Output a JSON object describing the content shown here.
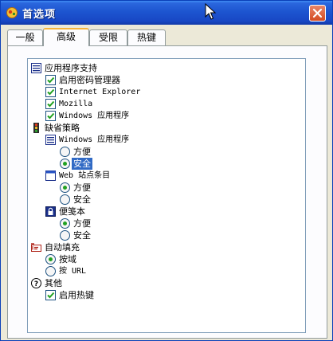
{
  "window": {
    "title": "首选项",
    "close_label": "✕"
  },
  "tabs": [
    {
      "label": "一般",
      "active": false
    },
    {
      "label": "高级",
      "active": true
    },
    {
      "label": "受限",
      "active": false
    },
    {
      "label": "热键",
      "active": false
    }
  ],
  "tree": {
    "app_support": {
      "label": "应用程序支持",
      "items": [
        {
          "label": "启用密码管理器",
          "checked": true
        },
        {
          "label": "Internet Explorer",
          "checked": true
        },
        {
          "label": "Mozilla",
          "checked": true
        },
        {
          "label": "Windows 应用程序",
          "checked": true
        }
      ]
    },
    "default_policy": {
      "label": "缺省策略",
      "windows_apps": {
        "label": "Windows 应用程序",
        "options": [
          {
            "label": "方便",
            "selected": false
          },
          {
            "label": "安全",
            "selected": true
          }
        ]
      },
      "web_sites": {
        "label": "Web 站点条目",
        "options": [
          {
            "label": "方便",
            "selected": true
          },
          {
            "label": "安全",
            "selected": false
          }
        ]
      },
      "notepad": {
        "label": "便笺本",
        "options": [
          {
            "label": "方便",
            "selected": true
          },
          {
            "label": "安全",
            "selected": false
          }
        ]
      }
    },
    "autofill": {
      "label": "自动填充",
      "options": [
        {
          "label": "按域",
          "selected": true
        },
        {
          "label": "按 URL",
          "selected": false
        }
      ]
    },
    "other": {
      "label": "其他",
      "items": [
        {
          "label": "启用热键",
          "checked": true
        }
      ]
    }
  }
}
